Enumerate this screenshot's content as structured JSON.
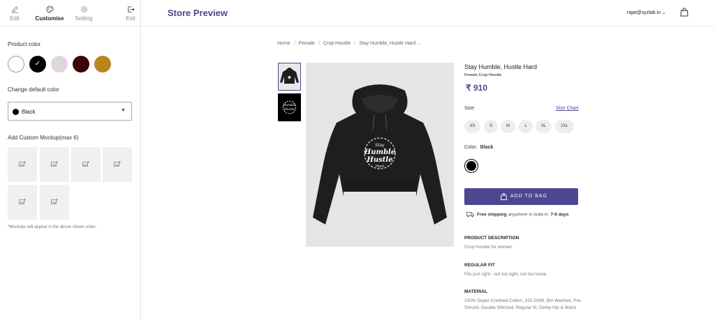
{
  "sidebar": {
    "tabs": [
      {
        "label": "Edit",
        "icon": "pencil-icon"
      },
      {
        "label": "Customise",
        "icon": "palette-icon"
      },
      {
        "label": "Setting",
        "icon": "gear-icon"
      },
      {
        "label": "Exit",
        "icon": "exit-icon"
      }
    ],
    "product_color_label": "Product color",
    "swatches": [
      "#ffffff",
      "#000000",
      "#e0d7de",
      "#3a0606",
      "#b8861f"
    ],
    "default_color_label": "Change default color",
    "default_color_value": "Black",
    "mockup_label": "Add Custom Mockup(max 6)",
    "mockup_note": "*Mockups will appear in the above shown order."
  },
  "header": {
    "title": "Store Preview",
    "user": "rajat@xyzlab.in"
  },
  "breadcrumb": [
    "Home",
    "Female",
    "Crop Hoodie",
    "Stay Humble, Hustle Hard ..."
  ],
  "product": {
    "name": "Stay Humble, Hustle Hard",
    "subtitle": "Female Crop Hoodie",
    "price": "₹ 910",
    "size_label": "Size:",
    "size_chart": "Size Chart",
    "sizes": [
      "XS",
      "S",
      "M",
      "L",
      "XL",
      "2XL"
    ],
    "color_label": "Color:",
    "color_value": "Black",
    "add_to_bag": "ADD TO BAG",
    "shipping_bold": "Free shipping",
    "shipping_mid": "anywhere in india in",
    "shipping_days": "7-9 days",
    "desc_title": "PRODUCT DESCRIPTION",
    "desc_text": "Crop Hoodie for women",
    "fit_title": "REGULAR FIT",
    "fit_text": "Fits just right - not too tight, not too loose.",
    "material_title": "MATERIAL",
    "material_text": "100% Super Combed Cotton, 320 GSM, Bio Washed, Pre-Shrunk, Double Stitched, Regular fit, Derby Hip & Waist",
    "print_text": [
      "Stay",
      "Humble",
      "Hustle",
      "Hard"
    ]
  },
  "colors": {
    "accent": "#4d4792"
  }
}
